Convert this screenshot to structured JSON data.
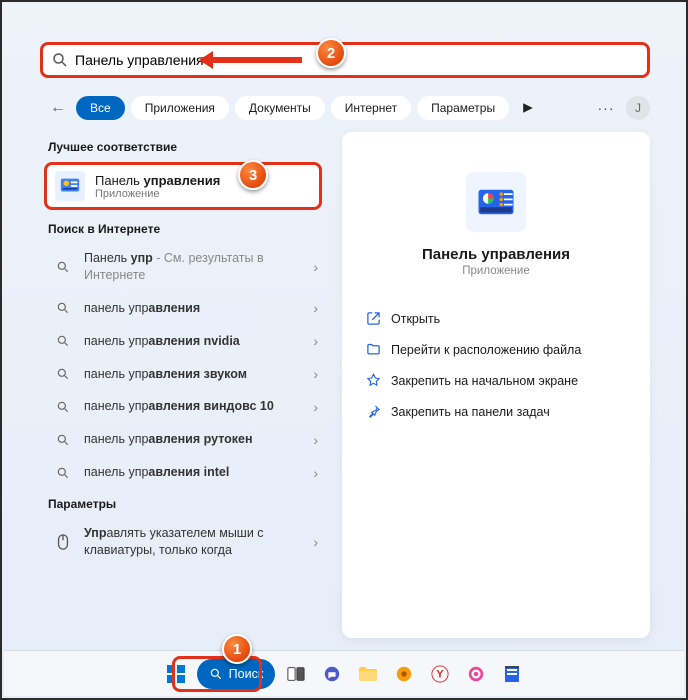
{
  "search": {
    "value": "Панель управления"
  },
  "tabs": {
    "back": "←",
    "items": [
      "Все",
      "Приложения",
      "Документы",
      "Интернет",
      "Параметры"
    ],
    "more": "···",
    "avatar": "J"
  },
  "left": {
    "bestHeader": "Лучшее соответствие",
    "best": {
      "q": "Панель ",
      "c": "управления",
      "sub": "Приложение"
    },
    "webHeader": "Поиск в Интернете",
    "web": [
      {
        "q": "Панель ",
        "c": "упр",
        "hint": " - См. результаты в Интернете"
      },
      {
        "q": "панель упр",
        "c": "авления"
      },
      {
        "q": "панель упр",
        "c": "авления nvidia"
      },
      {
        "q": "панель упр",
        "c": "авления звуком"
      },
      {
        "q": "панель упр",
        "c": "авления виндовс 10"
      },
      {
        "q": "панель упр",
        "c": "авления рутокен"
      },
      {
        "q": "панель упр",
        "c": "авления intel"
      }
    ],
    "settingsHeader": "Параметры",
    "settings": [
      {
        "q": "Упр",
        "c": "авлять указателем мыши с клавиатуры, только когда"
      }
    ]
  },
  "right": {
    "title": "Панель управления",
    "sub": "Приложение",
    "actions": [
      "Открыть",
      "Перейти к расположению файла",
      "Закрепить на начальном экране",
      "Закрепить на панели задач"
    ]
  },
  "taskbar": {
    "search": "Поиск"
  },
  "badges": {
    "b1": "1",
    "b2": "2",
    "b3": "3"
  }
}
